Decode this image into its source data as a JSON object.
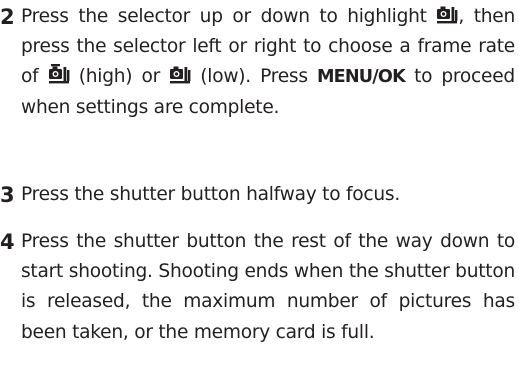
{
  "steps": [
    {
      "number": "2",
      "parts": {
        "p1": "Press the selector up or down to highlight",
        "p2": ", then press the selector left or right to choose a frame rate of",
        "p3": "(high) or",
        "p4": "(low).  Press",
        "bold": "MENU/OK",
        "p5": "to proceed when settings are complete."
      },
      "icons": [
        "continuous-mode-icon",
        "continuous-high-icon",
        "continuous-low-icon"
      ]
    },
    {
      "number": "3",
      "text": "Press the shutter button halfway to focus."
    },
    {
      "number": "4",
      "text": "Press the shutter button the rest of the way down to start shooting.  Shooting ends when the shutter button is released, the maximum number of pictures has been taken, or the memory card is full."
    }
  ]
}
